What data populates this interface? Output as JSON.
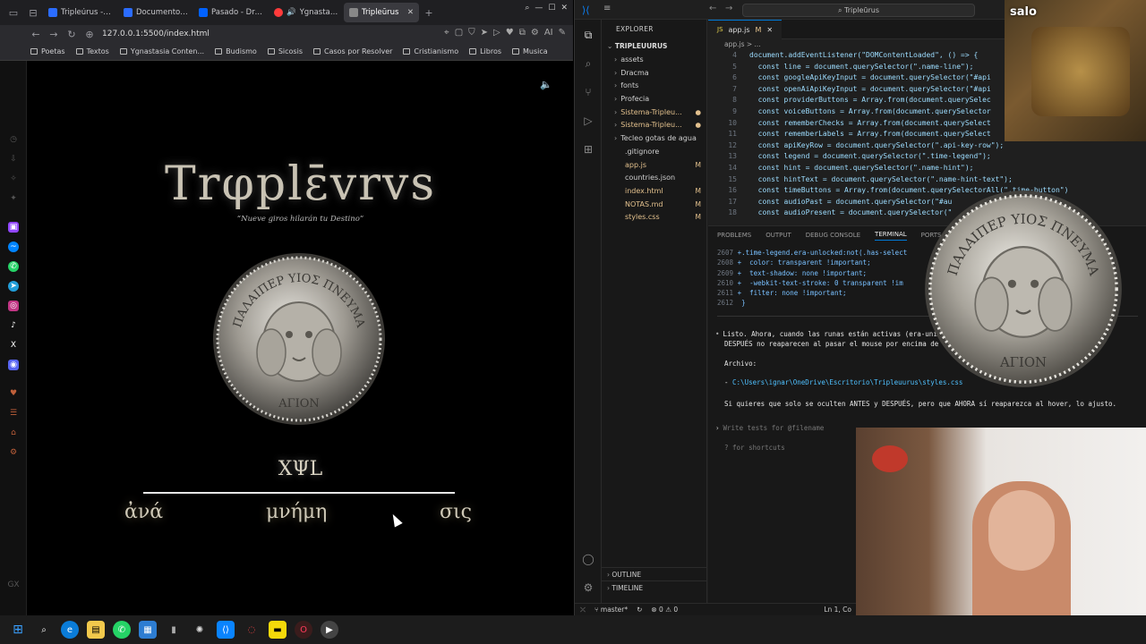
{
  "browser": {
    "tabs": [
      {
        "label": "Tripleúrus - Do",
        "color": "#2b6cff"
      },
      {
        "label": "Documento sin",
        "color": "#2b6cff"
      },
      {
        "label": "Pasado - Drop",
        "color": "#0061ff"
      },
      {
        "label": "Ygnastasia",
        "color": "#ff3b3b"
      },
      {
        "label": "Tripleūrus",
        "color": "#888888"
      }
    ],
    "url": "127.0.0.1:5500/index.html",
    "bookmarks": [
      "Poetas",
      "Textos",
      "Ygnastasia Conten...",
      "Budismo",
      "Sicosis",
      "Casos por Resolver",
      "Cristianismo",
      "Libros",
      "Musica"
    ]
  },
  "page": {
    "title": "Trφplε̅̄vrνs",
    "title_plain": "Trφplɛ̄vrvs",
    "subtitle": "“Nueve giros hilarán tu Destino”",
    "coin_top": "ΠΑΛΑΙΠΕΡ ΥΙΟΣ ΠΝΕΥΜΑ",
    "coin_bottom": "ΑΓΙΟΝ",
    "chi": "XΨL",
    "words": [
      "ἀνά",
      "μνήμη",
      "σις"
    ]
  },
  "vscode": {
    "search": "Tripleūrus",
    "explorer_label": "EXPLORER",
    "root": "TRIPLEUURUS",
    "files": [
      {
        "name": "assets",
        "folder": true,
        "mark": ""
      },
      {
        "name": "Dracma",
        "folder": true,
        "mark": ""
      },
      {
        "name": "fonts",
        "folder": true,
        "mark": ""
      },
      {
        "name": "Profecia",
        "folder": true,
        "mark": ""
      },
      {
        "name": "Sistema-Tripleu...",
        "folder": true,
        "mark": "●"
      },
      {
        "name": "Sistema-Tripleu...",
        "folder": true,
        "mark": "●"
      },
      {
        "name": "Tecleo gotas de agua",
        "folder": true,
        "mark": ""
      },
      {
        "name": ".gitignore",
        "folder": false,
        "mark": ""
      },
      {
        "name": "app.js",
        "folder": false,
        "mark": "M"
      },
      {
        "name": "countries.json",
        "folder": false,
        "mark": ""
      },
      {
        "name": "index.html",
        "folder": false,
        "mark": "M"
      },
      {
        "name": "NOTAS.md",
        "folder": false,
        "mark": "M"
      },
      {
        "name": "styles.css",
        "folder": false,
        "mark": "M"
      }
    ],
    "outline": "OUTLINE",
    "timeline": "TIMELINE",
    "editor_tab": "app.js",
    "editor_tab_mark": "M",
    "breadcrumb": "app.js > ...",
    "code": [
      {
        "n": "4",
        "t": "document.addEventListener(\"DOMContentLoaded\", () => {"
      },
      {
        "n": "5",
        "t": "  const line = document.querySelector(\".name-line\");"
      },
      {
        "n": "6",
        "t": "  const googleApiKeyInput = document.querySelector(\"#api"
      },
      {
        "n": "7",
        "t": "  const openAiApiKeyInput = document.querySelector(\"#api"
      },
      {
        "n": "8",
        "t": "  const providerButtons = Array.from(document.querySelec"
      },
      {
        "n": "9",
        "t": "  const voiceButtons = Array.from(document.querySelector"
      },
      {
        "n": "10",
        "t": "  const rememberChecks = Array.from(document.querySelect"
      },
      {
        "n": "11",
        "t": "  const rememberLabels = Array.from(document.querySelect"
      },
      {
        "n": "12",
        "t": "  const apiKeyRow = document.querySelector(\".api-key-row\");"
      },
      {
        "n": "13",
        "t": "  const legend = document.querySelector(\".time-legend\");"
      },
      {
        "n": "14",
        "t": "  const hint = document.querySelector(\".name-hint\");"
      },
      {
        "n": "15",
        "t": "  const hintText = document.querySelector(\".name-hint-text\");"
      },
      {
        "n": "16",
        "t": "  const timeButtons = Array.from(document.querySelectorAll(\".time-button\")"
      },
      {
        "n": "17",
        "t": "  const audioPast = document.querySelector(\"#au"
      },
      {
        "n": "18",
        "t": "  const audioPresent = document.querySelector(\""
      }
    ],
    "panel_tabs": [
      "PROBLEMS",
      "OUTPUT",
      "DEBUG CONSOLE",
      "TERMINAL",
      "PORTS"
    ],
    "diff": [
      {
        "n": "2607",
        "t": "+.time-legend.era-unlocked:not(.has-select"
      },
      {
        "n": "2608",
        "t": "+  color: transparent !important;"
      },
      {
        "n": "2609",
        "t": "+  text-shadow: none !important;"
      },
      {
        "n": "2610",
        "t": "+  -webkit-text-stroke: 0 transparent !im"
      },
      {
        "n": "2611",
        "t": "+  filter: none !important;"
      },
      {
        "n": "2612",
        "t": " }"
      }
    ],
    "chat_1": "Listo. Ahora, cuando las runas están activas (era-uni",
    "chat_1b": "DESPUÉS no reaparecen al pasar el mouse por encima de las runas.",
    "chat_archivo": "Archivo:",
    "chat_path": "C:\\Users\\ignar\\OneDrive\\Escritorio\\Tripleuurus\\styles.css",
    "chat_2": "Si quieres que solo se oculten ANTES y DESPUÉS, pero que AHORA sí reaparezca al hover, lo ajusto.",
    "prompt_placeholder": "Write tests for @filename",
    "shortcuts": "? for shortcuts",
    "status_branch": "master*",
    "status_errors": "⊗ 0 ⚠ 0",
    "status_pos": "Ln 1, Co"
  },
  "overlay": {
    "stream_tag": "salo"
  },
  "colors": {
    "accent": "#0078d4",
    "modified": "#e2c08d"
  }
}
